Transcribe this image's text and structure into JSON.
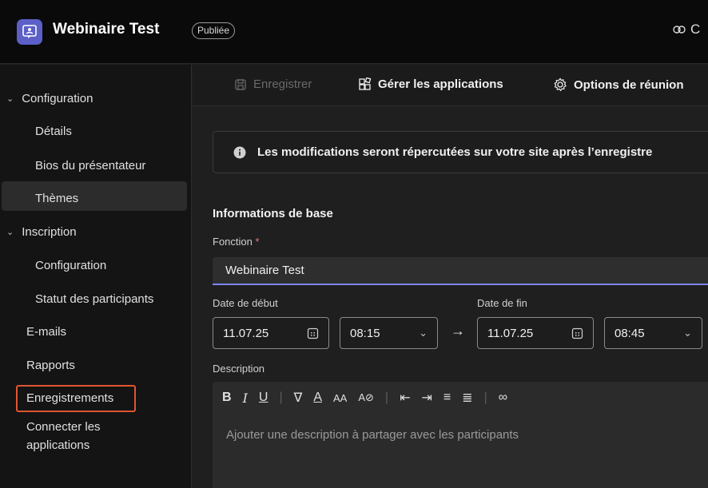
{
  "header": {
    "title": "Webinaire Test",
    "status": "Publiée",
    "link_label": "C"
  },
  "sidebar": {
    "groups": [
      {
        "label": "Configuration",
        "items": [
          "Détails",
          "Bios du présentateur",
          "Thèmes"
        ]
      },
      {
        "label": "Inscription",
        "items": [
          "Configuration",
          "Statut des participants"
        ]
      }
    ],
    "items": [
      "E-mails",
      "Rapports",
      "Enregistrements"
    ],
    "connect_line1": "Connecter les",
    "connect_line2": "applications",
    "selected": "Détails"
  },
  "toolbar": {
    "save_label": "Enregistrer",
    "apps_label": "Gérer les applications",
    "options_label": "Options de réunion"
  },
  "info": {
    "message": "Les modifications seront répercutées sur votre site après l’enregistre"
  },
  "form": {
    "section_title": "Informations de base",
    "title_label": "Fonction",
    "required_mark": "*",
    "title_value": "Webinaire Test",
    "start_label": "Date de début",
    "end_label": "Date de fin",
    "start_date": "11.07.25",
    "start_time": "08:15",
    "end_date": "11.07.25",
    "end_time": "08:45",
    "description_label": "Description",
    "description_placeholder": "Ajouter une description à partager avec les participants"
  },
  "colors": {
    "accent": "#5b5fc7",
    "underline": "#7f85f5",
    "highlight": "#e05530"
  }
}
